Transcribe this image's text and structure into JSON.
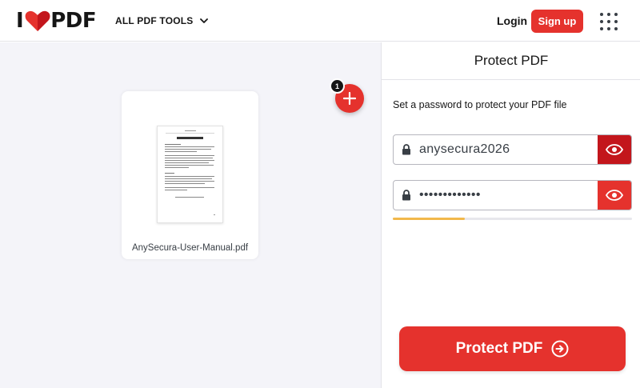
{
  "header": {
    "logo_left": "I",
    "logo_right": "PDF",
    "tools_menu_label": "ALL PDF TOOLS",
    "login_label": "Login",
    "signup_label": "Sign up"
  },
  "workspace": {
    "file_count_badge": "1",
    "file": {
      "name": "AnySecura-User-Manual.pdf"
    }
  },
  "panel": {
    "title": "Protect PDF",
    "description": "Set a password to protect your PDF file",
    "password_value": "anysecura2026",
    "repeat_password_masked": "•••••••••••••",
    "strength_fraction": 0.3,
    "action_label": "Protect PDF"
  },
  "icons": {
    "brand_heart": "heart-icon",
    "menu_chevron": "chevron-down-icon",
    "apps": "apps-grid-icon",
    "add": "plus-icon",
    "lock": "lock-icon",
    "eye": "eye-icon",
    "action": "arrow-circle-right-icon"
  },
  "colors": {
    "brand_red": "#E5322D",
    "eye_active_red": "#C3161C",
    "strength_color": "#F2B84B",
    "workspace_bg": "#f4f4f9"
  }
}
